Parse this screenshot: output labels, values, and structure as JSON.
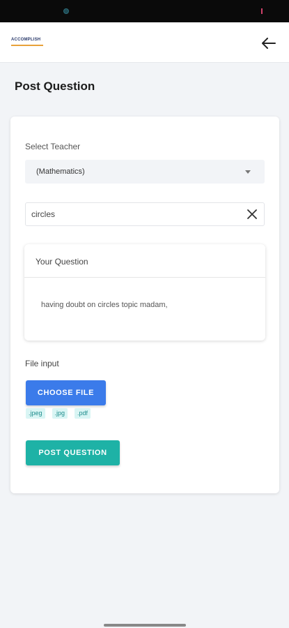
{
  "app": {
    "logo_text": "ACCOMPLISH",
    "back_icon": "arrow-left-icon"
  },
  "page": {
    "title": "Post Question"
  },
  "form": {
    "select_teacher_label": "Select Teacher",
    "selected_teacher": "(Mathematics)",
    "topic_value": "circles",
    "topic_placeholder": "",
    "question_heading": "Your Question",
    "question_text": "having doubt on circles topic madam,",
    "file_input_label": "File input",
    "choose_file_label": "CHOOSE FILE",
    "file_types": [
      ".jpeg",
      ".jpg",
      ".pdf"
    ],
    "post_button_label": "POST QUESTION"
  },
  "colors": {
    "choose_file": "#3b7bea",
    "post_question": "#1eb2a6",
    "tag_bg": "#d9f5f4",
    "tag_text": "#1e8c8c"
  }
}
